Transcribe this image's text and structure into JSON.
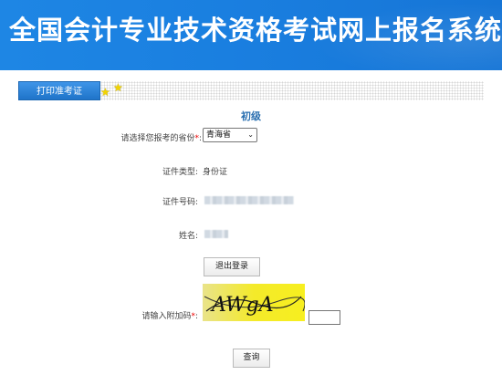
{
  "banner": {
    "title": "全国会计专业技术资格考试网上报名系统"
  },
  "tabs": {
    "active_label": "打印准考证"
  },
  "form": {
    "level": "初级",
    "province_label": "请选择您报考的省份",
    "required_mark": "*",
    "colon": ":",
    "province_value": "青海省",
    "id_type_label": "证件类型:",
    "id_type_value": "身份证",
    "id_number_label": "证件号码:",
    "name_label": "姓名:",
    "logout_button": "退出登录",
    "captcha_label": "请输入附加码",
    "captcha_text": "AWgA",
    "query_button": "查询"
  },
  "colors": {
    "banner_blue": "#1a7fe0",
    "tab_blue": "#2a82d8",
    "required_red": "#e00000"
  },
  "icons": [
    "star-icon",
    "star-icon",
    "dropdown-caret-icon"
  ]
}
